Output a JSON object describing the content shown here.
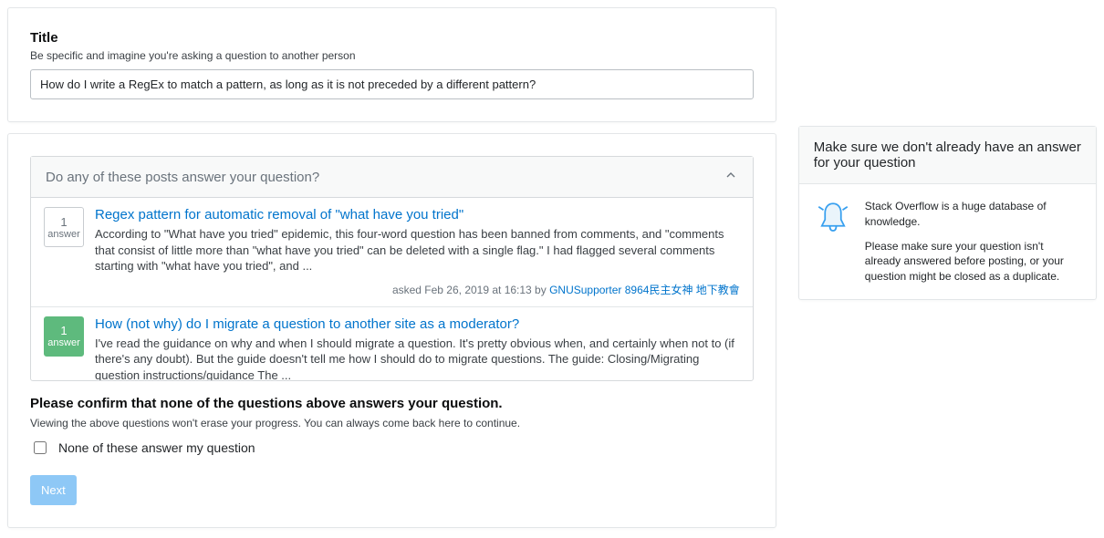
{
  "title_section": {
    "label": "Title",
    "hint": "Be specific and imagine you're asking a question to another person",
    "value": "How do I write a RegEx to match a pattern, as long as it is not preceded by a different pattern?"
  },
  "similar": {
    "header": "Do any of these posts answer your question?",
    "posts": [
      {
        "count": "1",
        "count_label": "answer",
        "answered": false,
        "title": "Regex pattern for automatic removal of \"what have you tried\"",
        "excerpt": "According to \"What have you tried\" epidemic, this four-word question has been banned from comments, and \"comments that consist of little more than \"what have you tried\" can be deleted with a single flag.\" I had flagged several comments starting with \"what have you tried\", and ...",
        "meta_prefix": "asked Feb 26, 2019 at 16:13 by ",
        "meta_user": "GNUSupporter 8964民主女神 地下教會"
      },
      {
        "count": "1",
        "count_label": "answer",
        "answered": true,
        "title": "How (not why) do I migrate a question to another site as a moderator?",
        "excerpt": "I've read the guidance on why and when I should migrate a question. It's pretty obvious when, and certainly when not to (if there's any doubt). But the guide doesn't tell me how I should do to migrate questions. The guide: Closing/Migrating question instructions/guidance The ..."
      }
    ]
  },
  "confirm": {
    "heading": "Please confirm that none of the questions above answers your question.",
    "hint": "Viewing the above questions won't erase your progress. You can always come back here to continue.",
    "checkbox_label": "None of these answer my question",
    "next": "Next"
  },
  "sidebar": {
    "heading": "Make sure we don't already have an answer for your question",
    "p1": "Stack Overflow is a huge database of knowledge.",
    "p2": "Please make sure your question isn't already answered before posting, or your question might be closed as a duplicate."
  }
}
